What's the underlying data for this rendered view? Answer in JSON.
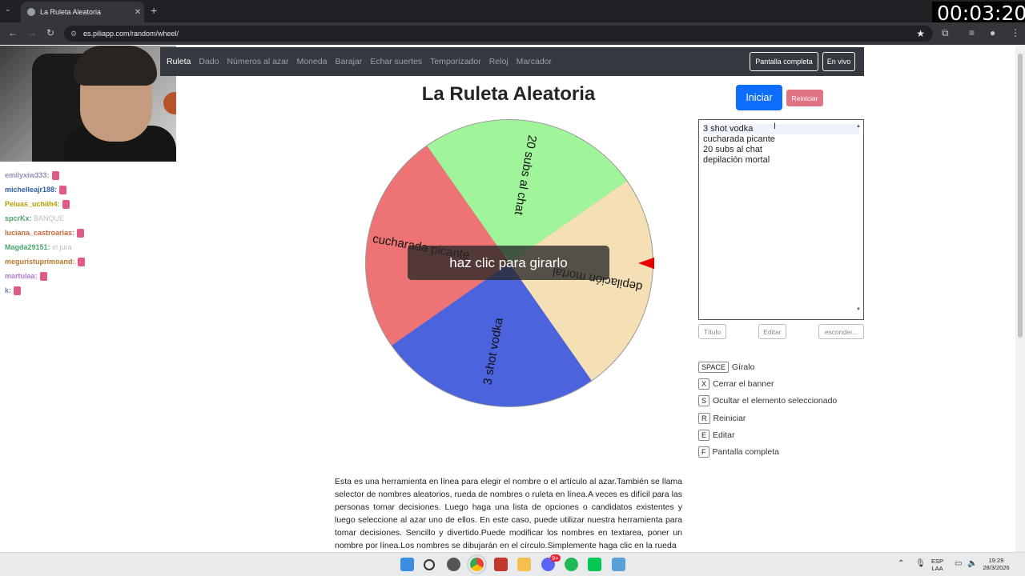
{
  "browser": {
    "tab_title": "La Ruleta Aleatoria",
    "url": "es.piliapp.com/random/wheel/",
    "timer": "00:03:20"
  },
  "nav": {
    "links": [
      "Ruleta",
      "Dado",
      "Números al azar",
      "Moneda",
      "Barajar",
      "Echar suertes",
      "Temporizador",
      "Reloj",
      "Marcador"
    ],
    "fullscreen_label": "Pantalla completa",
    "live_label": "En vivo"
  },
  "chat": [
    {
      "user": "emilyxiw333",
      "color": "#9b8ab8",
      "msg": ""
    },
    {
      "user": "michelleajr188",
      "color": "#2f5fa8",
      "msg": ""
    },
    {
      "user": "Peluas_uchiih4",
      "color": "#b0a000",
      "msg": ""
    },
    {
      "user": "spcrKx",
      "color": "#4da36d",
      "msg": "BANQUE"
    },
    {
      "user": "luciana_castroarias",
      "color": "#c46a3b",
      "msg": ""
    },
    {
      "user": "Magda29151",
      "color": "#4aa56f",
      "msg": "el jura"
    },
    {
      "user": "meguristuprimoand",
      "color": "#b8782e",
      "msg": ""
    },
    {
      "user": "martulaa",
      "color": "#b07bd0",
      "msg": ""
    },
    {
      "user": "k",
      "color": "#6a7fc0",
      "msg": ""
    }
  ],
  "main": {
    "title": "La Ruleta Aleatoria",
    "start_label": "Iniciar",
    "reset_label": "Reiniciar",
    "overlay_text": "haz clic para girarlo",
    "options": [
      "3 shot vodka",
      "cucharada picante",
      "20 subs al chat",
      "depilación mortal"
    ],
    "title_btn": "Título",
    "edit_btn": "Editar",
    "hide_btn": "esconder..."
  },
  "wheel": {
    "segments": [
      {
        "label": "20 subs al chat",
        "color": "#a0f49a"
      },
      {
        "label": "depilación mortal",
        "color": "#f4e0b4"
      },
      {
        "label": "3 shot vodka",
        "color": "#4b63dc"
      },
      {
        "label": "cucharada picante",
        "color": "#ee7374"
      }
    ],
    "pointer_color": "#e60000"
  },
  "shortcuts": [
    {
      "key": "SPACE",
      "label": "Gíralo"
    },
    {
      "key": "X",
      "label": "Cerrar el banner"
    },
    {
      "key": "S",
      "label": "Ocultar el elemento seleccionado"
    },
    {
      "key": "R",
      "label": "Reiniciar"
    },
    {
      "key": "E",
      "label": "Editar"
    },
    {
      "key": "F",
      "label": "Pantalla completa"
    }
  ],
  "description": "Esta es una herramienta en línea para elegir el nombre o el artículo al azar.También se llama selector de nombres aleatorios, rueda de nombres o ruleta en línea.A veces es difícil para las personas tomar decisiones. Luego haga una lista de opciones o candidatos existentes y luego seleccione al azar uno de ellos. En este caso, puede utilizar nuestra herramienta para tomar decisiones. Sencillo y divertido.Puede modificar los nombres en textarea, poner un nombre por línea.Los nombres se dibujarán en el círculo.Simplemente haga clic en la rueda",
  "taskbar": {
    "lang": "ESP",
    "region": "LAA",
    "time": "19:29",
    "date": "28/3/2026",
    "discord_badge": "9+"
  }
}
